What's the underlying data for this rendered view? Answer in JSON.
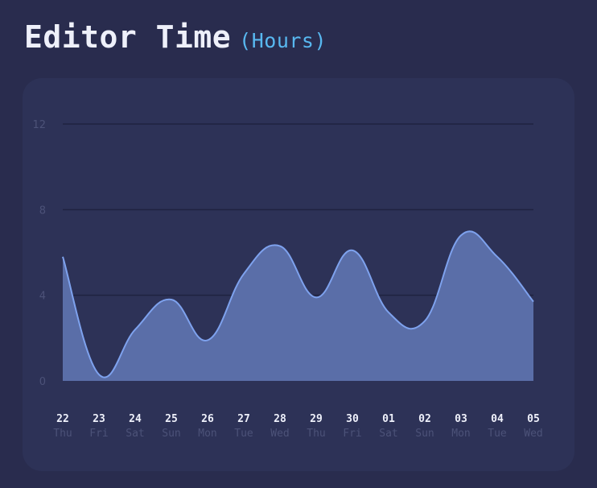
{
  "header": {
    "title": "Editor Time",
    "unit": "(Hours)"
  },
  "colors": {
    "background": "#292c4e",
    "card": "#2d3257",
    "title": "#eef0fa",
    "unit": "#58b8f0",
    "line": "#7ea2ee",
    "fill": "#5a6ea8",
    "grid": "#1f2240",
    "tick": "#4c5278"
  },
  "chart_data": {
    "type": "area",
    "title": "Editor Time (Hours)",
    "xlabel": "",
    "ylabel": "Hours",
    "ylim": [
      0,
      12
    ],
    "yticks": [
      0,
      4,
      8,
      12
    ],
    "grid": true,
    "curve": "smooth",
    "categories": [
      {
        "day": "22",
        "weekday": "Thu"
      },
      {
        "day": "23",
        "weekday": "Fri"
      },
      {
        "day": "24",
        "weekday": "Sat"
      },
      {
        "day": "25",
        "weekday": "Sun"
      },
      {
        "day": "26",
        "weekday": "Mon"
      },
      {
        "day": "27",
        "weekday": "Tue"
      },
      {
        "day": "28",
        "weekday": "Wed"
      },
      {
        "day": "29",
        "weekday": "Thu"
      },
      {
        "day": "30",
        "weekday": "Fri"
      },
      {
        "day": "01",
        "weekday": "Sat"
      },
      {
        "day": "02",
        "weekday": "Sun"
      },
      {
        "day": "03",
        "weekday": "Mon"
      },
      {
        "day": "04",
        "weekday": "Tue"
      },
      {
        "day": "05",
        "weekday": "Wed"
      }
    ],
    "series": [
      {
        "name": "Editor Time",
        "values": [
          5.8,
          0.3,
          2.4,
          3.8,
          1.9,
          5.0,
          6.3,
          3.9,
          6.1,
          3.2,
          2.8,
          6.8,
          5.8,
          3.7
        ]
      }
    ]
  }
}
